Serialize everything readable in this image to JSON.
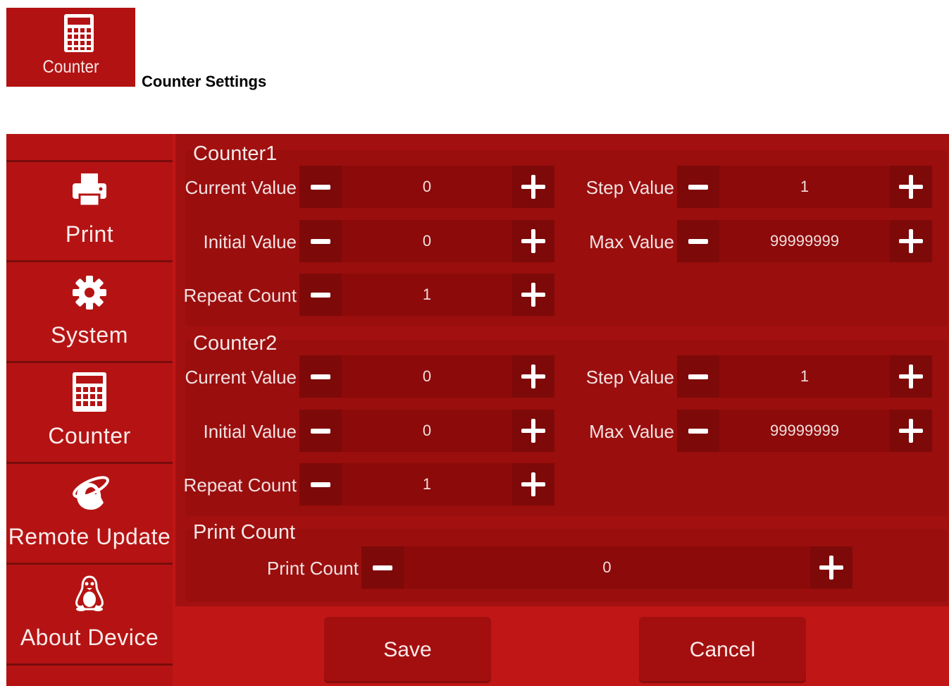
{
  "header": {
    "tile_label": "Counter",
    "title": "Counter Settings"
  },
  "sidebar": {
    "items": [
      {
        "label": "Print",
        "icon": "printer-icon"
      },
      {
        "label": "System",
        "icon": "gear-icon"
      },
      {
        "label": "Counter",
        "icon": "calculator-icon"
      },
      {
        "label": "Remote  Update",
        "icon": "internet-explorer-icon"
      },
      {
        "label": "About  Device",
        "icon": "linux-penguin-icon"
      }
    ]
  },
  "counter1": {
    "title": "Counter1",
    "current_value": {
      "label": "Current  Value",
      "value": "0"
    },
    "step_value": {
      "label": "Step  Value",
      "value": "1"
    },
    "initial_value": {
      "label": "Initial  Value",
      "value": "0"
    },
    "max_value": {
      "label": "Max  Value",
      "value": "99999999"
    },
    "repeat_count": {
      "label": "Repeat  Count",
      "value": "1"
    }
  },
  "counter2": {
    "title": "Counter2",
    "current_value": {
      "label": "Current  Value",
      "value": "0"
    },
    "step_value": {
      "label": "Step  Value",
      "value": "1"
    },
    "initial_value": {
      "label": "Initial  Value",
      "value": "0"
    },
    "max_value": {
      "label": "Max  Value",
      "value": "99999999"
    },
    "repeat_count": {
      "label": "Repeat  Count",
      "value": "1"
    }
  },
  "print_count": {
    "title": "Print  Count",
    "label": "Print  Count",
    "value": "0"
  },
  "buttons": {
    "save": "Save",
    "cancel": "Cancel"
  },
  "colors": {
    "brand_red": "#c01616",
    "panel_red": "#9a0e0e",
    "button_red": "#7e0909"
  }
}
